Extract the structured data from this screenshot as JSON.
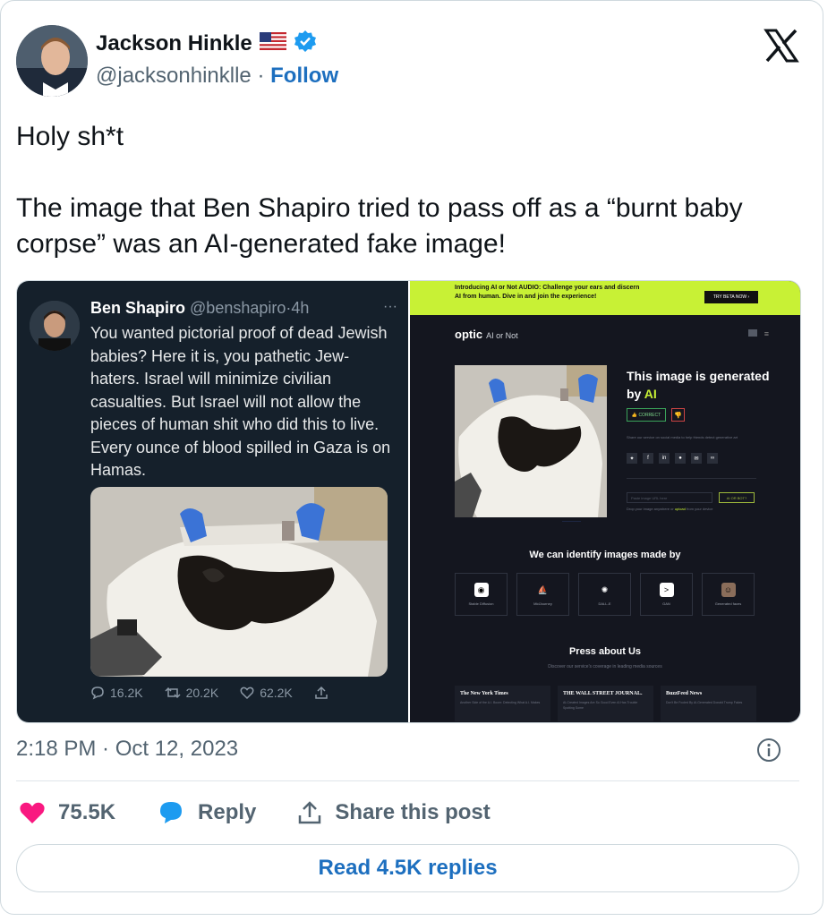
{
  "author": {
    "name": "Jackson Hinkle",
    "handle": "@jacksonhinklle",
    "follow_label": "Follow",
    "flag_icon": "us-flag-icon",
    "verified_icon": "verified-badge-icon"
  },
  "platform_icon": "x-logo-icon",
  "tweet": {
    "line1": "Holy sh*t",
    "line2": "The image that Ben Shapiro tried to pass off as a “burnt baby corpse” was an AI-generated fake image!"
  },
  "media_left": {
    "name": "Ben Shapiro",
    "handle": "@benshapiro",
    "age": "4h",
    "text": "You wanted pictorial proof of dead Jewish babies? Here it is, you pathetic Jew-haters. Israel will minimize civilian casualties. But Israel will not allow the pieces of human shit who did this to live. Every ounce of blood spilled in Gaza is on Hamas.",
    "replies": "16.2K",
    "retweets": "20.2K",
    "likes": "62.2K"
  },
  "media_right": {
    "banner_text": "Introducing AI or Not AUDIO: Challenge your ears and discern AI from human. Dive in and join the experience!",
    "banner_button": "TRY BETA NOW",
    "logo": "optic",
    "logo_sub": "AI or Not",
    "result_prefix": "This image is generated by",
    "result_ai": "AI",
    "correct_label": "CORRECT",
    "share_text": "Share our service on social media to help friends detect generative art",
    "url_placeholder": "Paste image URL here",
    "url_button": "AI OR BOT?",
    "drop_text": "Drop your image anywhere or",
    "drop_upload": "upload",
    "drop_suffix": "from your device",
    "identify_title": "We can identify images made by",
    "generators": [
      "Stable Diffusion",
      "MidJourney",
      "DALL-E",
      "GAN",
      "Generated faces"
    ],
    "press_title": "Press about Us",
    "press_sub": "Discover our service's coverage in leading media sources",
    "press": [
      {
        "logo": "The New York Times",
        "line": "Another Side of the A.I. Boom: Detecting What A.I. Makes"
      },
      {
        "logo": "THE WALL STREET JOURNAL.",
        "line": "AI-Created Images Are So Good Even AI Has Trouble Spotting Some"
      },
      {
        "logo": "BuzzFeed News",
        "line": "Don't Be Fooled By AI-Generated Donald Trump Fakes"
      }
    ]
  },
  "meta": {
    "timestamp": "2:18 PM · Oct 12, 2023"
  },
  "actions": {
    "like_count": "75.5K",
    "reply_label": "Reply",
    "share_label": "Share this post",
    "read_replies": "Read 4.5K replies"
  },
  "colors": {
    "link_blue": "#1d6fbf",
    "heart_pink": "#f91880",
    "optic_lime": "#c8f135"
  }
}
